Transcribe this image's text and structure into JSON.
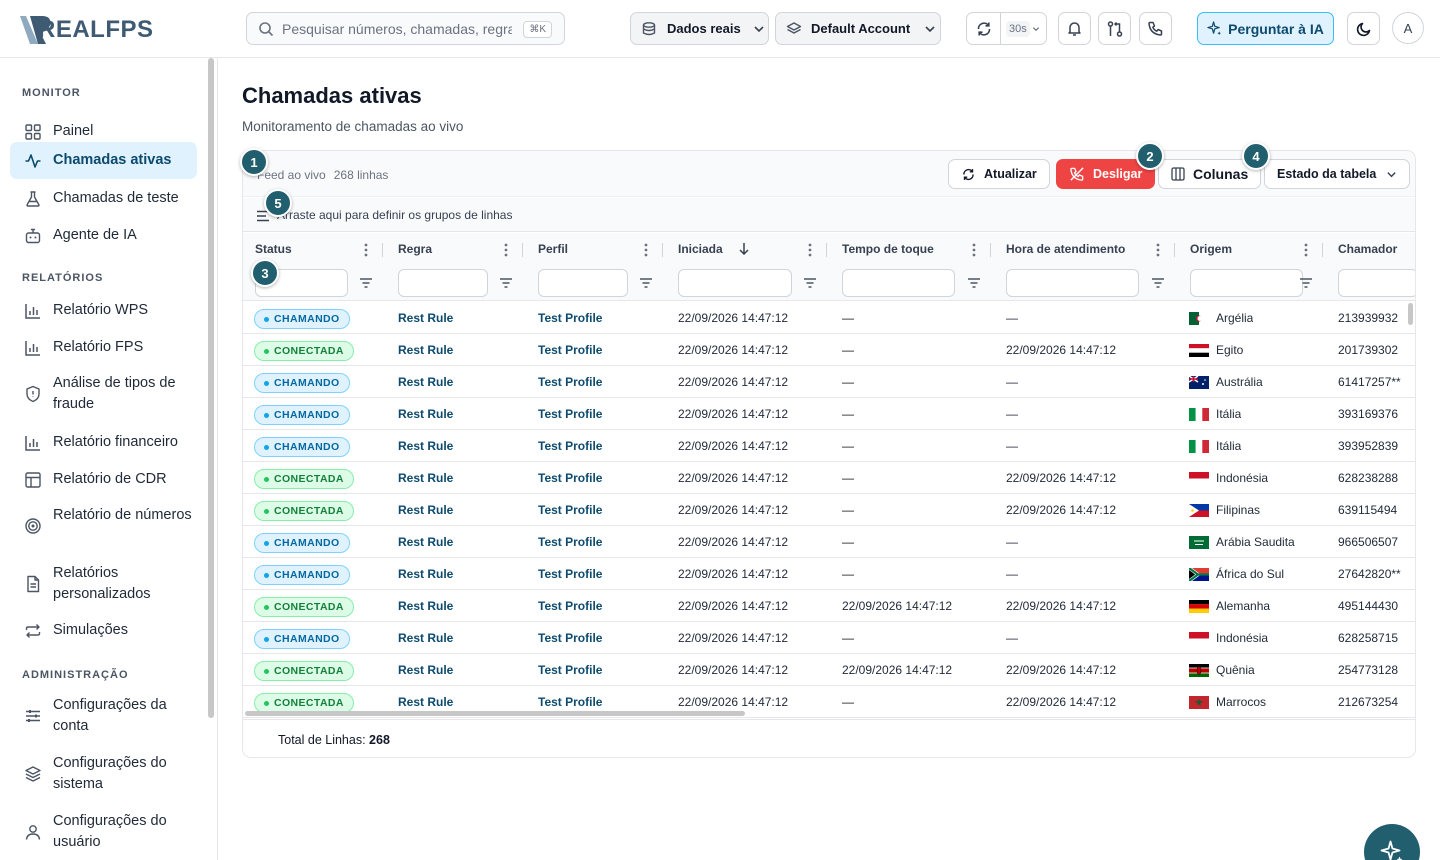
{
  "app": {
    "logo_text": "REALFPS"
  },
  "search": {
    "placeholder": "Pesquisar números, chamadas, regras...",
    "shortcut": "⌘K"
  },
  "topbar": {
    "data_source": "Dados reais",
    "account": "Default Account",
    "refresh_interval": "30s",
    "ai_button": "Perguntar à IA",
    "avatar_initial": "A",
    "icons": [
      "database-icon",
      "layers-icon",
      "refresh-icon",
      "bell-icon",
      "git-compare-icon",
      "phone-icon",
      "sparkle-icon",
      "moon-icon"
    ]
  },
  "sidebar": {
    "sections": [
      {
        "title": "MONITOR",
        "items": [
          {
            "label": "Painel",
            "icon": "grid-icon",
            "active": false
          },
          {
            "label": "Chamadas ativas",
            "icon": "activity-icon",
            "active": true
          },
          {
            "label": "Chamadas de teste",
            "icon": "flask-icon",
            "active": false
          },
          {
            "label": "Agente de IA",
            "icon": "bot-icon",
            "active": false
          }
        ]
      },
      {
        "title": "RELATÓRIOS",
        "items": [
          {
            "label": "Relatório WPS",
            "icon": "bar-chart-icon"
          },
          {
            "label": "Relatório FPS",
            "icon": "bar-chart-icon"
          },
          {
            "label": "Análise de tipos de fraude",
            "icon": "shield-icon"
          },
          {
            "label": "Relatório financeiro",
            "icon": "bar-chart-icon"
          },
          {
            "label": "Relatório de CDR",
            "icon": "table-icon"
          },
          {
            "label": "Relatório de números",
            "icon": "target-icon"
          },
          {
            "label": "Relatórios personalizados",
            "icon": "file-icon"
          },
          {
            "label": "Simulações",
            "icon": "repeat-icon"
          }
        ]
      },
      {
        "title": "ADMINISTRAÇÃO",
        "items": [
          {
            "label": "Configurações da conta",
            "icon": "sliders-icon"
          },
          {
            "label": "Configurações do sistema",
            "icon": "layers-icon"
          },
          {
            "label": "Configurações do usuário",
            "icon": "user-icon"
          }
        ]
      }
    ]
  },
  "page": {
    "title": "Chamadas ativas",
    "subtitle": "Monitoramento de chamadas ao vivo"
  },
  "toolbar": {
    "live_label": "Feed ao vivo",
    "row_count": "268 linhas",
    "refresh": "Atualizar",
    "hangup": "Desligar",
    "columns": "Colunas",
    "table_state": "Estado da tabela",
    "group_hint": "Arraste aqui para definir os grupos de linhas"
  },
  "table": {
    "columns": [
      "Status",
      "Regra",
      "Perfil",
      "Iniciada",
      "Tempo de toque",
      "Hora de atendimento",
      "Origem",
      "Chamador"
    ],
    "sort_column": "Iniciada",
    "rows": [
      {
        "status": "CHAMANDO",
        "rule": "Rest Rule",
        "profile": "Test Profile",
        "started": "22/09/2026 14:47:12",
        "ring": "—",
        "answer": "—",
        "origin": "Argélia",
        "flag": "dz",
        "caller": "213939932"
      },
      {
        "status": "CONECTADA",
        "rule": "Rest Rule",
        "profile": "Test Profile",
        "started": "22/09/2026 14:47:12",
        "ring": "—",
        "answer": "22/09/2026 14:47:12",
        "origin": "Egito",
        "flag": "eg",
        "caller": "201739302"
      },
      {
        "status": "CHAMANDO",
        "rule": "Rest Rule",
        "profile": "Test Profile",
        "started": "22/09/2026 14:47:12",
        "ring": "—",
        "answer": "—",
        "origin": "Austrália",
        "flag": "au",
        "caller": "61417257**"
      },
      {
        "status": "CHAMANDO",
        "rule": "Rest Rule",
        "profile": "Test Profile",
        "started": "22/09/2026 14:47:12",
        "ring": "—",
        "answer": "—",
        "origin": "Itália",
        "flag": "it",
        "caller": "393169376"
      },
      {
        "status": "CHAMANDO",
        "rule": "Rest Rule",
        "profile": "Test Profile",
        "started": "22/09/2026 14:47:12",
        "ring": "—",
        "answer": "—",
        "origin": "Itália",
        "flag": "it",
        "caller": "393952839"
      },
      {
        "status": "CONECTADA",
        "rule": "Rest Rule",
        "profile": "Test Profile",
        "started": "22/09/2026 14:47:12",
        "ring": "—",
        "answer": "22/09/2026 14:47:12",
        "origin": "Indonésia",
        "flag": "id",
        "caller": "628238288"
      },
      {
        "status": "CONECTADA",
        "rule": "Rest Rule",
        "profile": "Test Profile",
        "started": "22/09/2026 14:47:12",
        "ring": "—",
        "answer": "22/09/2026 14:47:12",
        "origin": "Filipinas",
        "flag": "ph",
        "caller": "639115494"
      },
      {
        "status": "CHAMANDO",
        "rule": "Rest Rule",
        "profile": "Test Profile",
        "started": "22/09/2026 14:47:12",
        "ring": "—",
        "answer": "—",
        "origin": "Arábia Saudita",
        "flag": "sa",
        "caller": "966506507"
      },
      {
        "status": "CHAMANDO",
        "rule": "Rest Rule",
        "profile": "Test Profile",
        "started": "22/09/2026 14:47:12",
        "ring": "—",
        "answer": "—",
        "origin": "África do Sul",
        "flag": "za",
        "caller": "27642820**"
      },
      {
        "status": "CONECTADA",
        "rule": "Rest Rule",
        "profile": "Test Profile",
        "started": "22/09/2026 14:47:12",
        "ring": "22/09/2026 14:47:12",
        "answer": "22/09/2026 14:47:12",
        "origin": "Alemanha",
        "flag": "de",
        "caller": "495144430"
      },
      {
        "status": "CHAMANDO",
        "rule": "Rest Rule",
        "profile": "Test Profile",
        "started": "22/09/2026 14:47:12",
        "ring": "—",
        "answer": "—",
        "origin": "Indonésia",
        "flag": "id",
        "caller": "628258715"
      },
      {
        "status": "CONECTADA",
        "rule": "Rest Rule",
        "profile": "Test Profile",
        "started": "22/09/2026 14:47:12",
        "ring": "22/09/2026 14:47:12",
        "answer": "22/09/2026 14:47:12",
        "origin": "Quênia",
        "flag": "ke",
        "caller": "254773128"
      },
      {
        "status": "CONECTADA",
        "rule": "Rest Rule",
        "profile": "Test Profile",
        "started": "22/09/2026 14:47:12",
        "ring": "—",
        "answer": "22/09/2026 14:47:12",
        "origin": "Marrocos",
        "flag": "ma",
        "caller": "212673254"
      }
    ]
  },
  "footer": {
    "total_label": "Total de Linhas:",
    "total_value": "268"
  },
  "markers": [
    "1",
    "2",
    "3",
    "4",
    "5"
  ],
  "colors": {
    "accent": "#215f6e",
    "active_bg": "#e0f2fe",
    "danger": "#ef4444",
    "connected": "#15803d",
    "ringing": "#0369a1"
  }
}
